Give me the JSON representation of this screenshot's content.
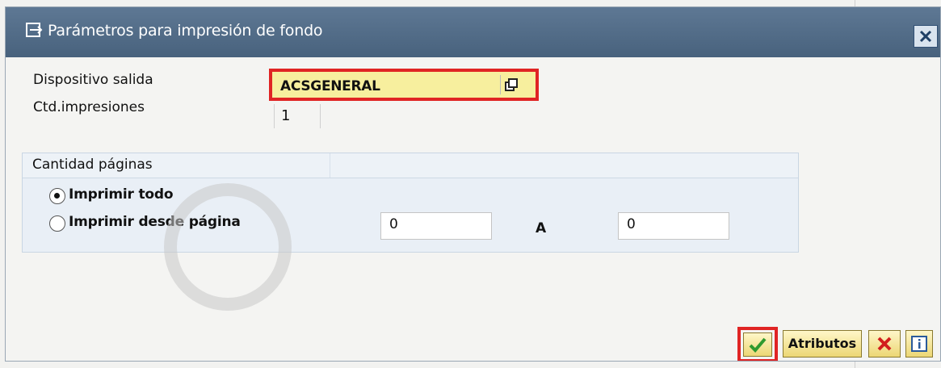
{
  "dialog": {
    "title": "Parámetros para impresión de fondo",
    "title_icon": "print-params-icon",
    "close_icon": "close-icon"
  },
  "fields": {
    "output_device_label": "Dispositivo salida",
    "output_device_value": "ACSGENERAL",
    "copies_label": "Ctd.impresiones",
    "copies_value": "1"
  },
  "pages_group": {
    "title": "Cantidad páginas",
    "options": [
      {
        "label": "Imprimir todo",
        "selected": true
      },
      {
        "label": "Imprimir desde página",
        "selected": false
      }
    ],
    "from_value": "0",
    "to_label": "A",
    "to_value": "0"
  },
  "buttons": {
    "confirm_icon": "checkmark-icon",
    "attributes_label": "Atributos",
    "cancel_icon": "cancel-x-icon",
    "info_icon": "info-icon"
  },
  "colors": {
    "titlebar": "#4f6985",
    "highlight_field": "#f7ef9e",
    "annotation_border": "#e02424",
    "group_background": "#e9eff6"
  }
}
